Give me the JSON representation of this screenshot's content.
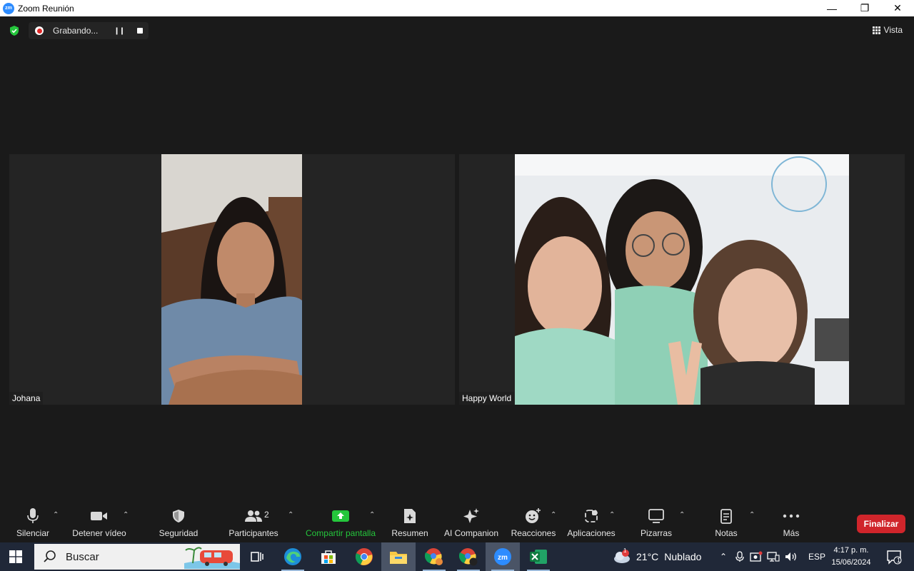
{
  "window": {
    "title": "Zoom Reunión",
    "minimize": "—",
    "restore": "❐",
    "close": "✕"
  },
  "meeting": {
    "recording_label": "Grabando...",
    "view_label": "Vista",
    "participants": [
      {
        "name": "Johana"
      },
      {
        "name": "Happy World"
      }
    ]
  },
  "toolbar": {
    "mute": "Silenciar",
    "video": "Detener vídeo",
    "security": "Seguridad",
    "participants": "Participantes",
    "participants_count": "2",
    "share": "Compartir pantalla",
    "summary": "Resumen",
    "ai": "AI Companion",
    "reactions": "Reacciones",
    "apps": "Aplicaciones",
    "whiteboards": "Pizarras",
    "notes": "Notas",
    "more": "Más",
    "end": "Finalizar"
  },
  "taskbar": {
    "search_label": "Buscar",
    "weather_temp": "21°C",
    "weather_text": "Nublado",
    "weather_badge": "1",
    "language": "ESP",
    "time": "4:17 p. m.",
    "date": "15/06/2024",
    "notifications": "1"
  },
  "colors": {
    "accent_green": "#25c63c",
    "end_red": "#d0252b",
    "zoom_blue": "#2d8cff"
  }
}
